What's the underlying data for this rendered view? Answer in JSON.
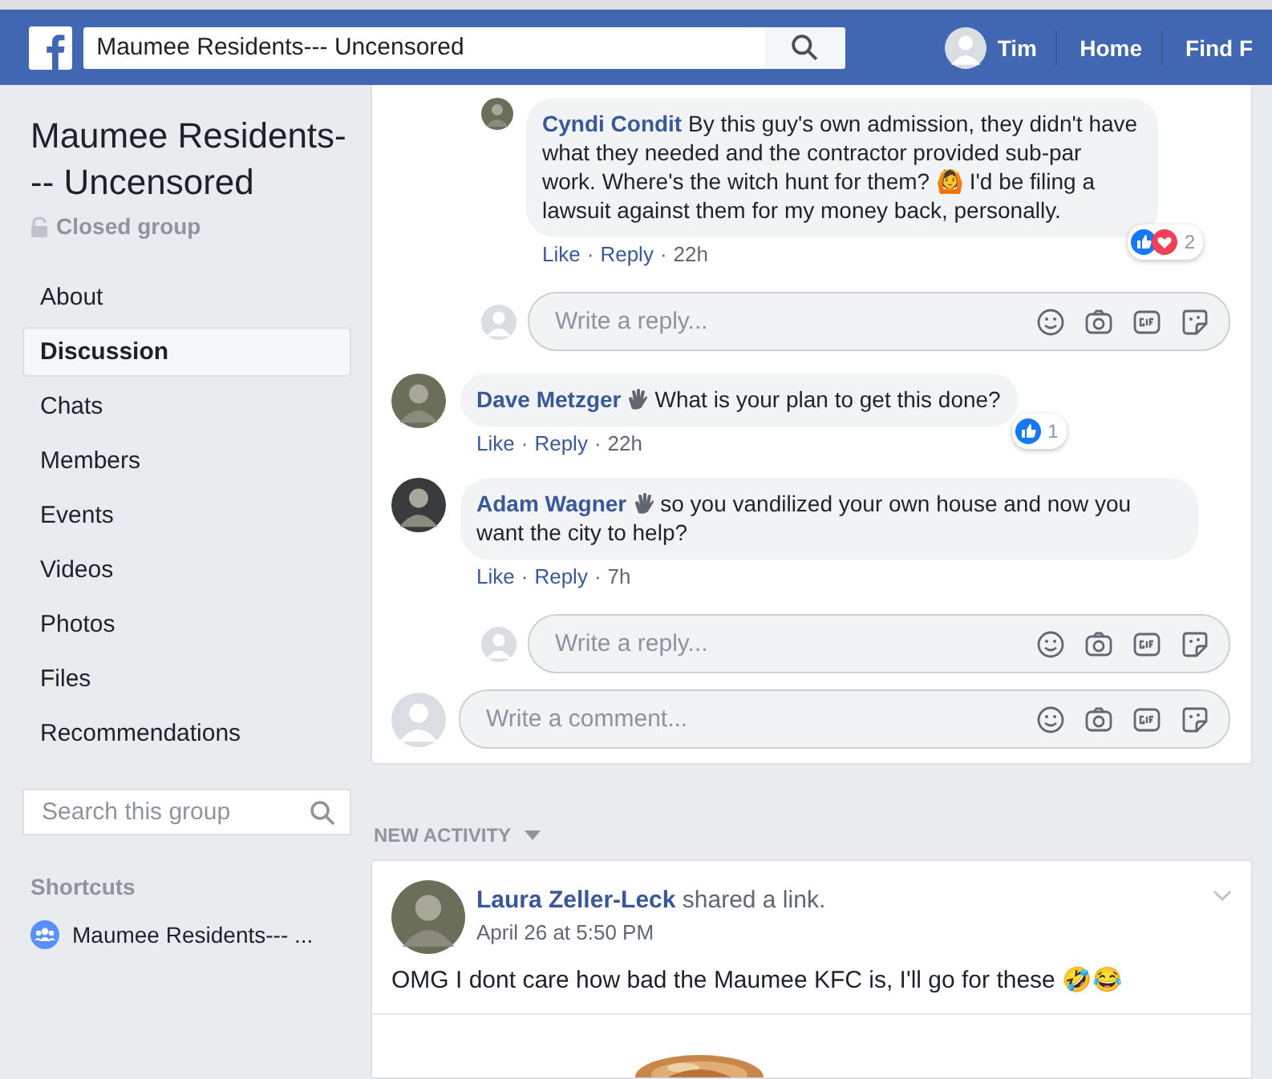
{
  "header": {
    "search_value": "Maumee Residents--- Uncensored",
    "user": "Tim",
    "nav": [
      "Home",
      "Find F"
    ]
  },
  "sidebar": {
    "group_name": "Maumee Residents--- Uncensored",
    "privacy": "Closed group",
    "items": [
      {
        "label": "About",
        "selected": false
      },
      {
        "label": "Discussion",
        "selected": true
      },
      {
        "label": "Chats",
        "selected": false
      },
      {
        "label": "Members",
        "selected": false
      },
      {
        "label": "Events",
        "selected": false
      },
      {
        "label": "Videos",
        "selected": false
      },
      {
        "label": "Photos",
        "selected": false
      },
      {
        "label": "Files",
        "selected": false
      },
      {
        "label": "Recommendations",
        "selected": false
      }
    ],
    "search": {
      "placeholder": "Search this group"
    },
    "shortcuts_title": "Shortcuts",
    "shortcuts": [
      "Maumee Residents--- ..."
    ]
  },
  "thread": [
    {
      "kind": "reply",
      "author": "Cyndi Condit",
      "badge": false,
      "text": "By this guy's own admission, they didn't have what they needed and the contractor provided sub-par work. Where's the witch hunt for them? 🙆 I'd be filing a lawsuit against them for my money back, personally.",
      "actions": [
        "Like",
        "Reply"
      ],
      "separator": "·",
      "time": "22h",
      "reactions": {
        "like": true,
        "love": true,
        "count": "2"
      }
    },
    {
      "kind": "reply_box",
      "placeholder": "Write a reply..."
    },
    {
      "kind": "comment",
      "author": "Dave Metzger",
      "badge": true,
      "text": "What is your plan to get this done?",
      "actions": [
        "Like",
        "Reply"
      ],
      "separator": "·",
      "time": "22h",
      "reactions": {
        "like": true,
        "love": false,
        "count": "1"
      }
    },
    {
      "kind": "comment",
      "author": "Adam Wagner",
      "badge": true,
      "text": "so you vandilized your own house and now you want the city to help?",
      "actions": [
        "Like",
        "Reply"
      ],
      "separator": "·",
      "time": "7h"
    },
    {
      "kind": "reply_box",
      "placeholder": "Write a reply..."
    },
    {
      "kind": "comment_box",
      "placeholder": "Write a comment..."
    }
  ],
  "feed_label": "NEW ACTIVITY",
  "post": {
    "author": "Laura Zeller-Leck",
    "action": "shared a link.",
    "time": "April 26 at 5:50 PM",
    "text": "OMG I dont care how bad the Maumee KFC is, I'll go for these 🤣😂"
  }
}
